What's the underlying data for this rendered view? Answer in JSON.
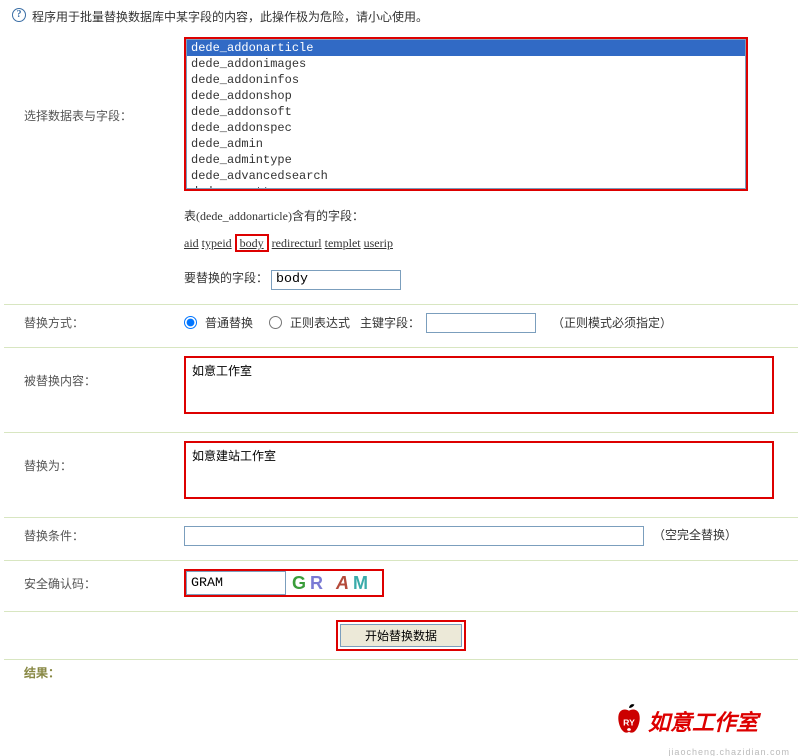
{
  "warning_text": "程序用于批量替换数据库中某字段的内容，此操作极为危险，请小心使用。",
  "labels": {
    "select_table": "选择数据表与字段：",
    "table_fields_prefix": "表(dede_addonarticle)含有的字段：",
    "field_to_replace": "要替换的字段：",
    "replace_method": "替换方式：",
    "normal_replace": "普通替换",
    "regex_replace": "正则表达式",
    "primary_key": "主键字段：",
    "regex_note": "（正则模式必须指定）",
    "replaced_content": "被替换内容：",
    "replace_to": "替换为：",
    "replace_condition": "替换条件：",
    "condition_note": "（空完全替换）",
    "security_code": "安全确认码：",
    "submit": "开始替换数据",
    "result": "结果："
  },
  "tables": [
    "dede_addonarticle",
    "dede_addonimages",
    "dede_addoninfos",
    "dede_addonshop",
    "dede_addonsoft",
    "dede_addonspec",
    "dede_admin",
    "dede_admintype",
    "dede_advancedsearch",
    "dede_arcatt"
  ],
  "selected_table_index": 0,
  "fields": [
    "aid",
    "typeid",
    "body",
    "redirecturl",
    "templet",
    "userip"
  ],
  "highlighted_field": "body",
  "form": {
    "replace_field_value": "body",
    "replace_method_value": "normal",
    "primary_key_value": "",
    "replaced_content_value": "如意工作室",
    "replace_to_value": "如意建站工作室",
    "replace_condition_value": "",
    "captcha_value": "GRAM"
  },
  "captcha_display": [
    "G",
    "R",
    "A",
    "M"
  ],
  "logo": {
    "ry": "RY",
    "text": "如意工作室"
  },
  "watermark": "jiaocheng.chazidian.com"
}
